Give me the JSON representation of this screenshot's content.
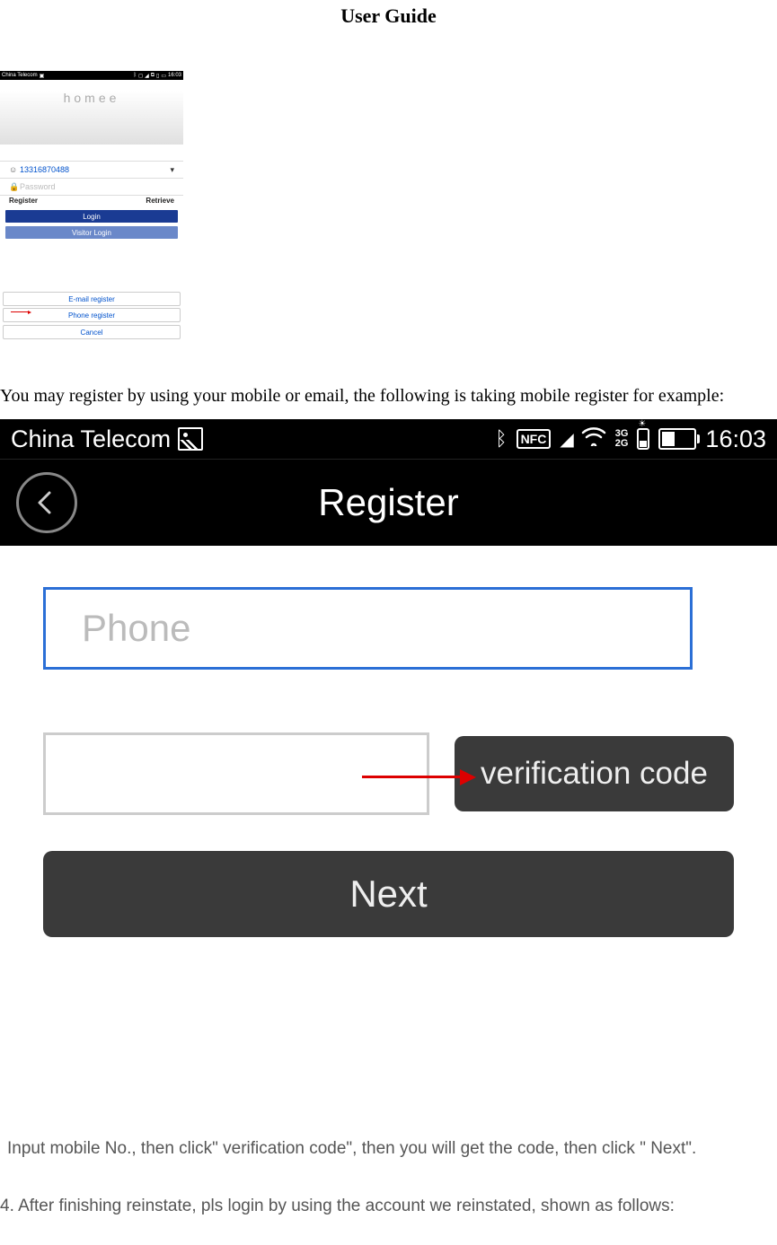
{
  "title": "User Guide",
  "screenshot1": {
    "statusbar": {
      "carrier": "China Telecom",
      "time": "16:03"
    },
    "logo": "homee",
    "phone_value": "13316870488",
    "password_placeholder": "Password",
    "register_label": "Register",
    "retrieve_label": "Retrieve",
    "login_label": "Login",
    "visitor_login_label": "Visitor Login",
    "email_register_label": "E-mail register",
    "phone_register_label": "Phone register",
    "cancel_label": "Cancel"
  },
  "paragraph1": "You may register by using your mobile or email,  the following is taking mobile register for example:",
  "screenshot2": {
    "statusbar": {
      "carrier": "China Telecom",
      "nfc": "NFC",
      "gg": "3G\n2G",
      "time": "16:03"
    },
    "navbar_title": "Register",
    "phone_placeholder": "Phone",
    "verification_button": "verification code",
    "next_button": "Next"
  },
  "caption": "Input mobile No., then click\" verification code\", then you will get the code, then click \" Next\".",
  "step4": "4. After finishing reinstate, pls login by using the account we reinstated, shown as follows:"
}
